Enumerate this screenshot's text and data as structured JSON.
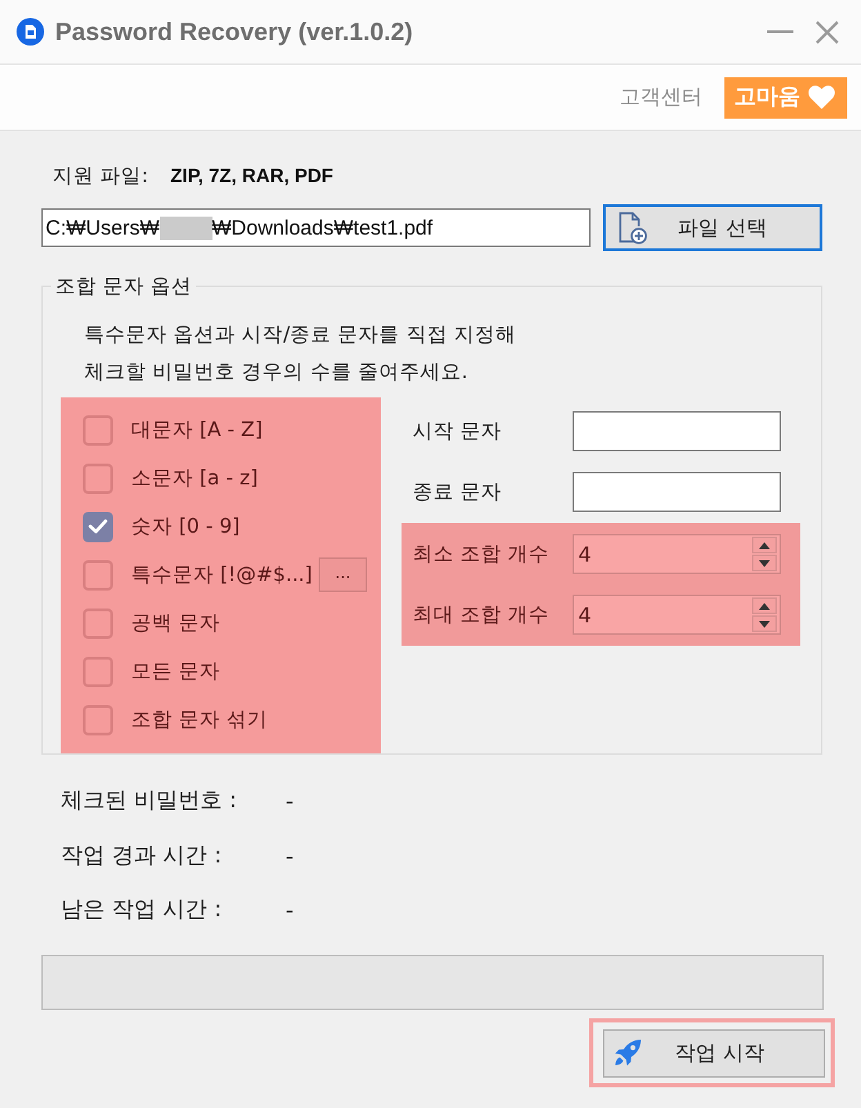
{
  "window": {
    "title": "Password Recovery (ver.1.0.2)"
  },
  "header": {
    "support_link": "고객센터",
    "thanks_button": "고마움"
  },
  "file": {
    "label": "지원 파일:",
    "formats": "ZIP, 7Z, RAR, PDF",
    "path_field": {
      "value_start": "C:₩Users₩",
      "redacted": true,
      "value_end": "₩Downloads₩test1.pdf"
    },
    "select_button": "파일 선택"
  },
  "options": {
    "title": "조합 문자 옵션",
    "description": [
      "특수문자 옵션과 시작/종료 문자를 직접 지정해",
      "체크할 비밀번호 경우의 수를 줄여주세요."
    ],
    "charsets": {
      "highlighted": true,
      "items": [
        {
          "label": "대문자 [A - Z]",
          "checked": false
        },
        {
          "label": "소문자 [a - z]",
          "checked": false
        },
        {
          "label": "숫자 [0 - 9]",
          "checked": true
        },
        {
          "label": "특수문자 [!@#$...]",
          "checked": false,
          "more_button": "..."
        },
        {
          "label": "공백 문자",
          "checked": false
        },
        {
          "label": "모든 문자",
          "checked": false
        },
        {
          "label": "조합 문자 섞기",
          "checked": false
        }
      ]
    },
    "fields": [
      {
        "label": "시작 문자"
      },
      {
        "label": "종료 문자"
      }
    ],
    "counts": {
      "highlighted": true,
      "items": [
        {
          "label": "최소 조합 개수",
          "value": "4"
        },
        {
          "label": "최대 조합 개수",
          "value": "4"
        }
      ]
    }
  },
  "status": [
    {
      "label": "체크된 비밀번호 :",
      "value": "-"
    },
    {
      "label": "작업 경과 시간 :",
      "value": "-"
    },
    {
      "label": "남은 작업 시간 :",
      "value": "-"
    }
  ],
  "progress": {
    "level": 0
  },
  "start_button": {
    "label": "작업 시작",
    "highlighted": true
  }
}
